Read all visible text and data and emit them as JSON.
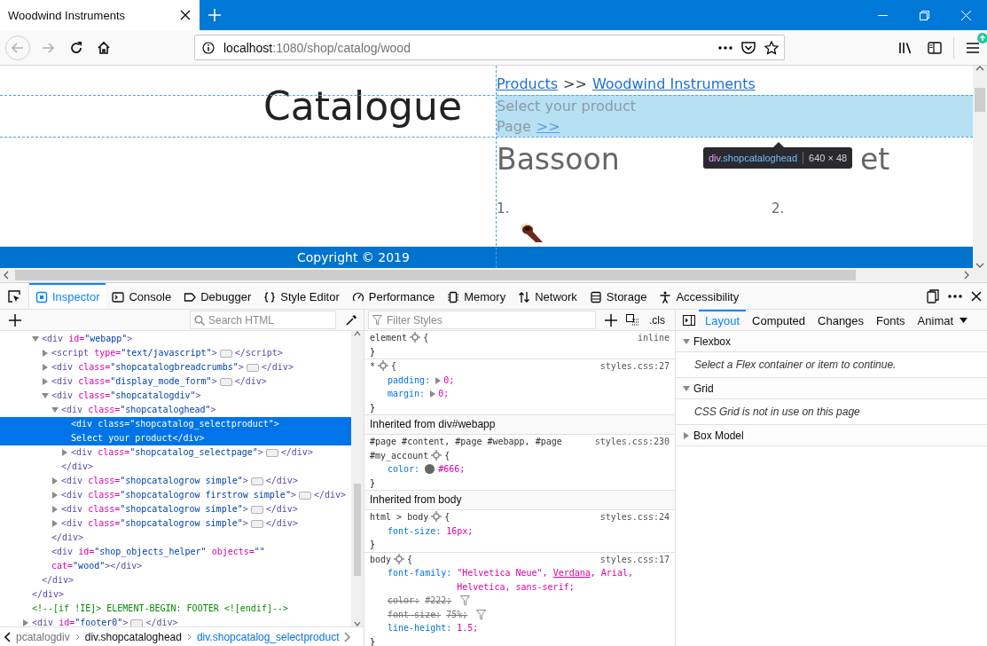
{
  "browser_tab": {
    "title": "Woodwind Instruments",
    "selected": true
  },
  "url": {
    "host": "localhost",
    "path": ":1080/shop/catalog/wood"
  },
  "page": {
    "heading": "Catalogue",
    "breadcrumbs": [
      {
        "kind": "link",
        "text": "Products"
      },
      {
        "kind": "separator",
        "text": ">>"
      },
      {
        "kind": "link",
        "text": "Woodwind Instruments"
      }
    ],
    "select_product": "Select your product",
    "page_label": "Page",
    "page_link": ">>",
    "products": [
      {
        "name": "Bassoon",
        "number": "1.",
        "picture": true
      },
      {
        "name": "et",
        "number": "2."
      }
    ],
    "tooltip": {
      "tag": "div",
      "class_name": ".shopcataloghead",
      "size": "640 × 48"
    },
    "footer": "Copyright © 2019"
  },
  "devtools": {
    "tools": [
      {
        "label": "Inspector",
        "selected": true
      },
      {
        "label": "Console",
        "selected": false
      },
      {
        "label": "Debugger",
        "selected": false
      },
      {
        "label": "Style Editor",
        "selected": false
      },
      {
        "label": "Performance",
        "selected": false
      },
      {
        "label": "Memory",
        "selected": false
      },
      {
        "label": "Network",
        "selected": false
      },
      {
        "label": "Storage",
        "selected": false
      },
      {
        "label": "Accessibility",
        "selected": false
      }
    ],
    "search_placeholder": "Search HTML",
    "filter_placeholder": "Filter Styles",
    "cls_button": ".cls",
    "markup": [
      {
        "kind": "element",
        "close": "</div>",
        "children": [
          {
            "kind": "element",
            "open": "<div id=\"webapp\">",
            "selected": false,
            "expanded": true,
            "close": "</div>",
            "children": [
              {
                "kind": "element",
                "open": "<script type=\"text/javascript\">",
                "selected": false,
                "expanded": false,
                "close": "</script>"
              },
              {
                "kind": "element",
                "open": "<div class=\"shopcatalogbreadcrumbs\">",
                "selected": false,
                "expanded": false,
                "close": "</div>"
              },
              {
                "kind": "element",
                "open": "<div class=\"display_mode_form\">",
                "selected": false,
                "expanded": false,
                "close": "</div>"
              },
              {
                "kind": "element",
                "open": "<div class=\"shopcatalogdiv\">",
                "selected": false,
                "expanded": true,
                "close": "</div>",
                "children": [
                  {
                    "kind": "element",
                    "open": "<div class=\"shopcataloghead\">",
                    "selected": false,
                    "expanded": true,
                    "close": "</div>",
                    "children": [
                      {
                        "kind": "element",
                        "lines": [
                          "<div class=\"shopcatalog_selectproduct\">",
                          "Select your product</div>"
                        ],
                        "selected": true
                      },
                      {
                        "kind": "element",
                        "open": "<div class=\"shopcatalog_selectpage\">",
                        "selected": false,
                        "expanded": false,
                        "close": "</div>"
                      }
                    ]
                  },
                  {
                    "kind": "element",
                    "open": "<div class=\"shopcatalogrow simple\">",
                    "selected": false,
                    "expanded": false,
                    "close": "</div>"
                  },
                  {
                    "kind": "element",
                    "open": "<div class=\"shopcatalogrow firstrow simple\">",
                    "selected": false,
                    "expanded": false,
                    "close": "</div>"
                  },
                  {
                    "kind": "element",
                    "open": "<div class=\"shopcatalogrow simple\">",
                    "selected": false,
                    "expanded": false,
                    "close": "</div>"
                  },
                  {
                    "kind": "element",
                    "open": "<div class=\"shopcatalogrow simple\">",
                    "selected": false,
                    "expanded": false,
                    "close": "</div>"
                  }
                ]
              },
              {
                "kind": "element",
                "lines": [
                  "<div id=\"shop_objects_helper\" objects=\"\"",
                  "cat=\"wood\"></div>"
                ],
                "selected": false
              }
            ]
          }
        ]
      },
      {
        "kind": "comment",
        "lines": [
          "<!--[if !IE]> ELEMENT-BEGIN: FOOTER <![endif]-->"
        ],
        "selected": false
      },
      {
        "kind": "element",
        "open": "<div id=\"footer0\">",
        "selected": false,
        "expanded": false,
        "close": "</div>"
      }
    ],
    "breadcrumbs": [
      {
        "text": "pcatalogdiv",
        "selected": false
      },
      {
        "text": "div.shopcataloghead",
        "selected": false
      },
      {
        "text": "div.shopcatalog_selectproduct",
        "selected": true
      }
    ],
    "rules": [
      {
        "kind": "rule",
        "selector": "element",
        "open": "{",
        "source": "inline",
        "close": "}"
      },
      {
        "kind": "rule",
        "selector": "*",
        "open": "{",
        "source": "styles.css:27",
        "close": "}",
        "declarations": [
          {
            "name": "padding:",
            "value": "0;",
            "expandable": true,
            "overridden": false
          },
          {
            "name": "margin:",
            "value": "0;",
            "expandable": true,
            "overridden": false
          }
        ]
      },
      {
        "kind": "header",
        "text": "Inherited from div#webapp"
      },
      {
        "kind": "rule",
        "selector": "#page #content, #page #webapp, #page #my_account",
        "open": "{",
        "source": "styles.css:230",
        "close": "}",
        "declarations": [
          {
            "name": "color:",
            "value": "#666;",
            "color": "#666666",
            "expandable": false,
            "overridden": false
          }
        ]
      },
      {
        "kind": "header",
        "text": "Inherited from body"
      },
      {
        "kind": "rule",
        "selector": "html > body",
        "open": "{",
        "source": "styles.css:24",
        "close": "}",
        "declarations": [
          {
            "name": "font-size:",
            "value": "16px;",
            "expandable": false,
            "overridden": false
          }
        ]
      },
      {
        "kind": "rule",
        "selector": "body",
        "open": "{",
        "source": "styles.css:17",
        "close": "}",
        "declarations": [
          {
            "name": "font-family:",
            "value_parts": [
              {
                "text": "\"Helvetica Neue\", ",
                "used": false
              },
              {
                "text": "Verdana",
                "used": true
              },
              {
                "text": ", Arial, Helvetica, sans-serif;",
                "used": false
              }
            ],
            "expandable": false,
            "overridden": false
          },
          {
            "name": "color:",
            "value": "#222;",
            "expandable": false,
            "overridden": true
          },
          {
            "name": "font-size:",
            "value": "75%;",
            "expandable": false,
            "overridden": true
          },
          {
            "name": "line-height:",
            "value": "1.5;",
            "expandable": false,
            "overridden": false
          }
        ]
      }
    ],
    "sidebar_tabs": [
      {
        "label": "Layout",
        "selected": true
      },
      {
        "label": "Computed",
        "selected": false
      },
      {
        "label": "Changes",
        "selected": false
      },
      {
        "label": "Fonts",
        "selected": false
      },
      {
        "label": "Animat",
        "selected": false
      }
    ],
    "layout_sections": [
      {
        "title": "Flexbox",
        "expanded": true,
        "message": "Select a Flex container or item to continue."
      },
      {
        "title": "Grid",
        "expanded": true,
        "message": "CSS Grid is not in use on this page"
      },
      {
        "title": "Box Model",
        "expanded": false
      }
    ]
  }
}
